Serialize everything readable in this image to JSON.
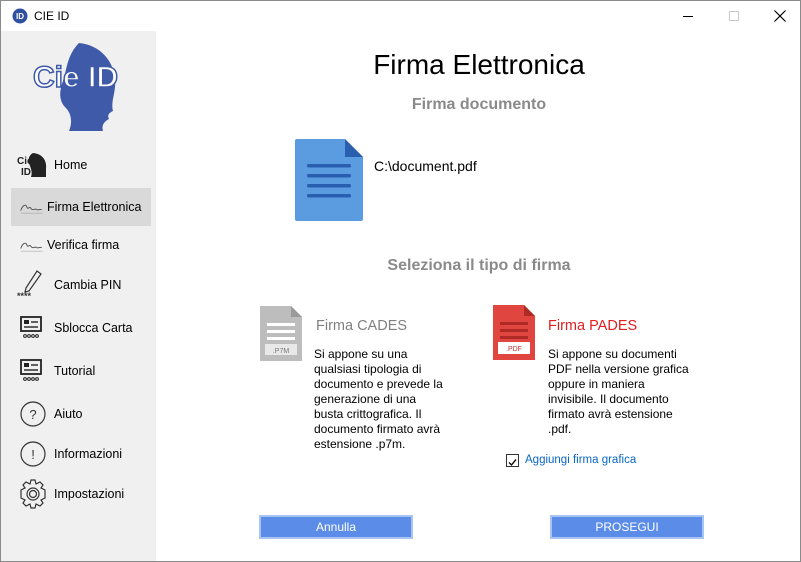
{
  "window": {
    "title": "CIE ID"
  },
  "sidebar": {
    "logo_text": "Cie ID",
    "items": [
      {
        "label": "Home",
        "icon": "cie-id-icon"
      },
      {
        "label": "Firma Elettronica",
        "icon": "signature-icon",
        "active": true
      },
      {
        "label": "Verifica firma",
        "icon": "signature-icon"
      },
      {
        "label": "Cambia PIN",
        "icon": "pen-pin-icon",
        "icon_text": "****"
      },
      {
        "label": "Sblocca Carta",
        "icon": "card-reader-icon"
      },
      {
        "label": "Tutorial",
        "icon": "card-reader-icon"
      },
      {
        "label": "Aiuto",
        "icon": "question-icon"
      },
      {
        "label": "Informazioni",
        "icon": "info-icon"
      },
      {
        "label": "Impostazioni",
        "icon": "gear-icon"
      }
    ]
  },
  "main": {
    "title": "Firma Elettronica",
    "subtitle": "Firma documento",
    "document_path": "C:\\document.pdf",
    "select_title": "Seleziona il tipo di firma",
    "options": [
      {
        "id": "cades",
        "title": "Firma CADES",
        "badge": ".P7M",
        "color": "#808080",
        "description": [
          "Si appone su una",
          "qualsiasi tipologia di",
          "documento e prevede la",
          "generazione di una",
          "busta crittografica. Il",
          "documento firmato avrà",
          "estensione .p7m."
        ]
      },
      {
        "id": "pades",
        "title": "Firma PADES",
        "badge": ".PDF",
        "color": "#e02020",
        "description": [
          "Si appone su documenti",
          "PDF nella versione grafica",
          "oppure in maniera",
          "invisibile. Il documento",
          "firmato avrà estensione",
          ".pdf."
        ]
      }
    ],
    "checkbox": {
      "label": "Aggiungi firma grafica",
      "checked": true
    },
    "buttons": {
      "cancel": "Annulla",
      "proceed": "PROSEGUI"
    }
  },
  "colors": {
    "accent": "#5b8de8",
    "logo_blue": "#3f5aa8",
    "doc_blue": "#5b9be0",
    "link": "#0b66c3"
  }
}
